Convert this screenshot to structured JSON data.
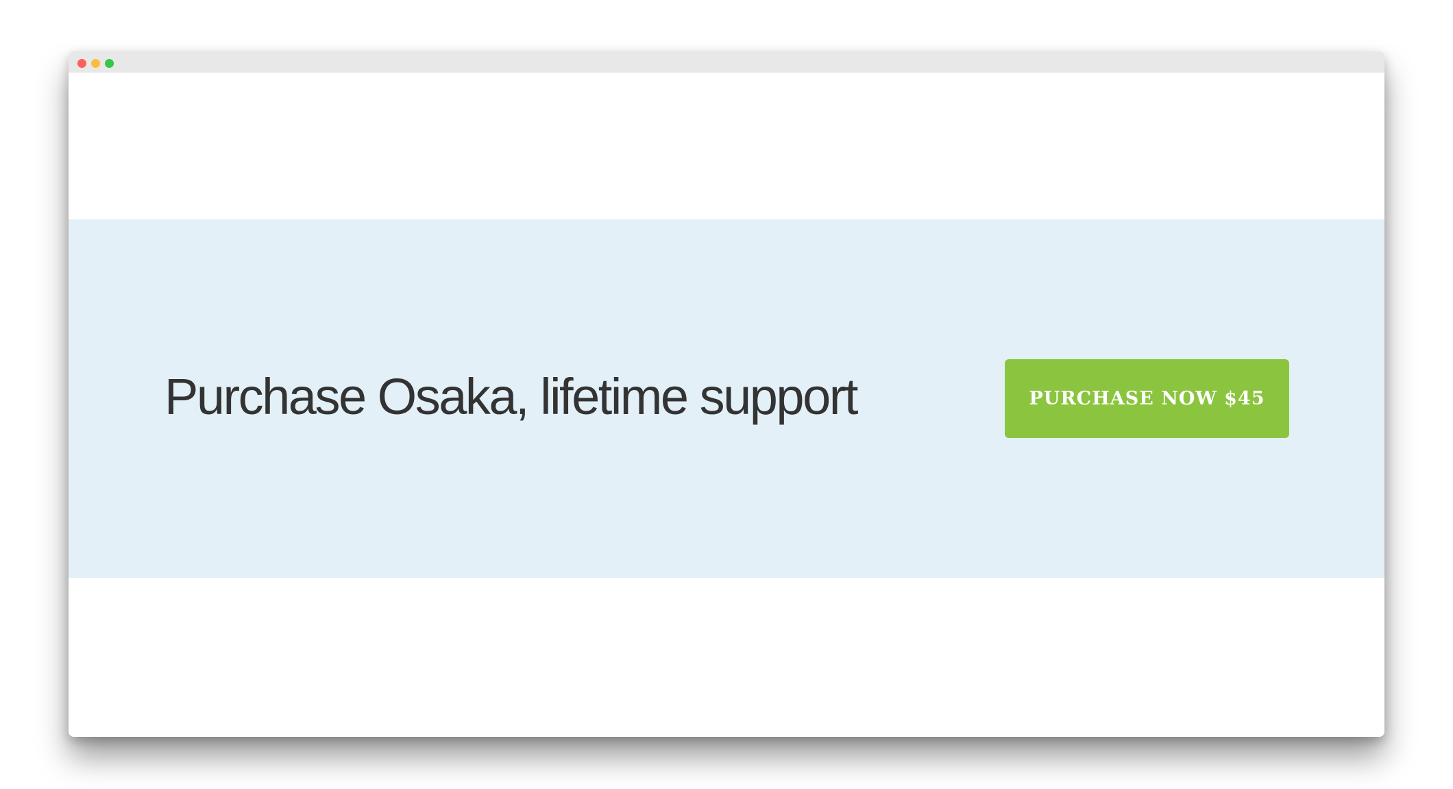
{
  "colors": {
    "titlebar": "#e8e8e8",
    "close": "#fc605c",
    "minimize": "#fdbc40",
    "maximize": "#34c84a",
    "band_background": "#e4f0f8",
    "headline_text": "#333333",
    "button_background": "#8bc53f",
    "button_text": "#ffffff"
  },
  "window": {
    "controls": [
      "close-icon",
      "minimize-icon",
      "maximize-icon"
    ]
  },
  "cta_section": {
    "headline": "Purchase Osaka, lifetime support",
    "button_label": "PURCHASE NOW $45"
  }
}
